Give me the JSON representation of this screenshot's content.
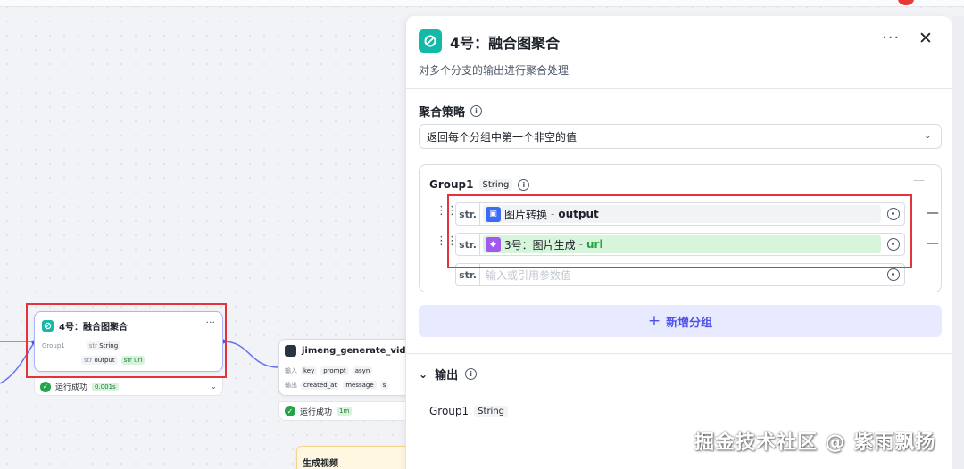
{
  "canvas": {
    "agg_node": {
      "title": "4号：融合图聚合",
      "more": "···",
      "group_label": "Group1",
      "type_string": "String",
      "output_name": "output",
      "url_name": "url",
      "str_prefix": "str",
      "status": "运行成功",
      "time": "0.001s"
    },
    "jimeng_node": {
      "title": "jimeng_generate_video",
      "in_label": "输入",
      "out_label": "输出",
      "inputs": [
        "key",
        "prompt",
        "asyn"
      ],
      "outputs": [
        "created_at",
        "message",
        "s"
      ],
      "status": "运行成功",
      "time": "1m"
    },
    "video_node": {
      "title": "生成视频"
    }
  },
  "panel": {
    "title": "4号：融合图聚合",
    "description": "对多个分支的输出进行聚合处理",
    "strategy_label": "聚合策略",
    "strategy_value": "返回每个分组中第一个非空的值",
    "group": {
      "name": "Group1",
      "type": "String",
      "rows": [
        {
          "type": "str.",
          "source": "图片转换",
          "sep": "-",
          "field": "output",
          "color": "#3b6cf5"
        },
        {
          "type": "str.",
          "source": "3号：图片生成",
          "sep": "-",
          "field": "url",
          "color": "#a259f0"
        }
      ],
      "placeholder_type": "str.",
      "placeholder": "输入或引用参数值"
    },
    "add_group": "新增分组",
    "output_label": "输出",
    "output_item": {
      "name": "Group1",
      "type": "String"
    }
  },
  "watermark": "掘金技术社区 @ 紫雨飘扬"
}
